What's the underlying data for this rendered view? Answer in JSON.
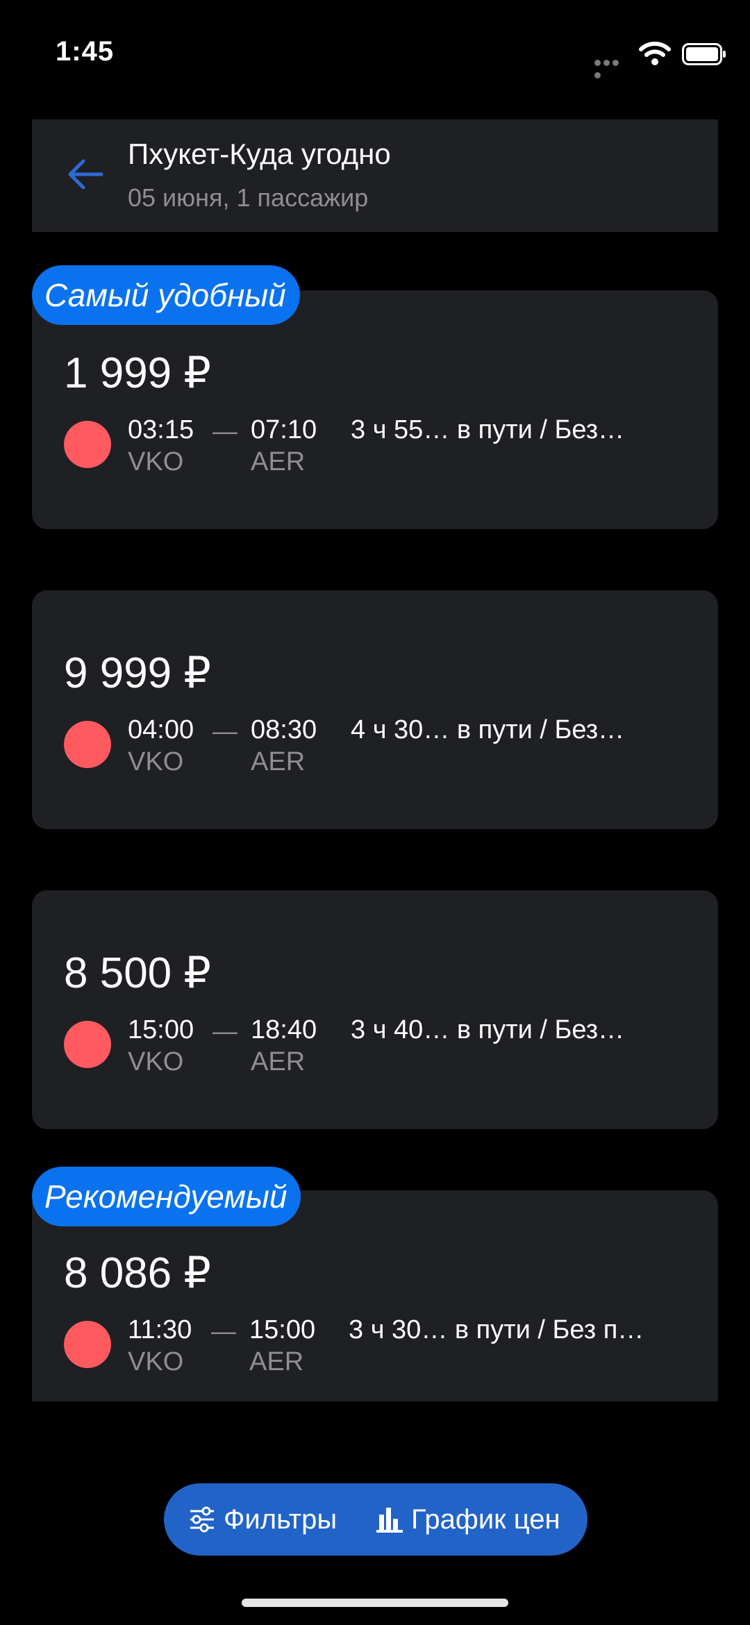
{
  "status_bar": {
    "time": "1:45",
    "icons": [
      "signal-dots-icon",
      "wifi-icon",
      "battery-icon"
    ]
  },
  "header": {
    "back_icon": "arrow-left-icon",
    "title": "Пхукет-Куда угодно",
    "subtitle": "05 июня, 1 пассажир",
    "accent": "#2e6ad6"
  },
  "tickets": [
    {
      "badge": "Самый удобный",
      "price": "1 999 ₽",
      "depart_time": "03:15",
      "arrive_time": "07:10",
      "depart_code": "VKO",
      "arrive_code": "AER",
      "dash": "—",
      "info": "3 ч 55… в пути / Без…"
    },
    {
      "badge": "",
      "price": "9 999 ₽",
      "depart_time": "04:00",
      "arrive_time": "08:30",
      "depart_code": "VKO",
      "arrive_code": "AER",
      "dash": "—",
      "info": "4 ч 30… в пути / Без…"
    },
    {
      "badge": "",
      "price": "8 500 ₽",
      "depart_time": "15:00",
      "arrive_time": "18:40",
      "depart_code": "VKO",
      "arrive_code": "AER",
      "dash": "—",
      "info": "3 ч 40… в пути / Без…"
    },
    {
      "badge": "Рекомендуемый",
      "price": "8 086 ₽",
      "depart_time": "11:30",
      "arrive_time": "15:00",
      "depart_code": "VKO",
      "arrive_code": "AER",
      "dash": "—",
      "info": "3 ч 30… в пути / Без п…"
    }
  ],
  "bottom_bar": {
    "filters_label": "Фильтры",
    "filters_icon": "sliders-icon",
    "chart_label": "График цен",
    "chart_icon": "bar-chart-icon"
  },
  "colors": {
    "background": "#000000",
    "card": "#1f2023",
    "badge": "#0a72ee",
    "airline": "#ff5a5f",
    "bottom_bar": "#2263c7",
    "secondary_text": "#8e8e93"
  }
}
